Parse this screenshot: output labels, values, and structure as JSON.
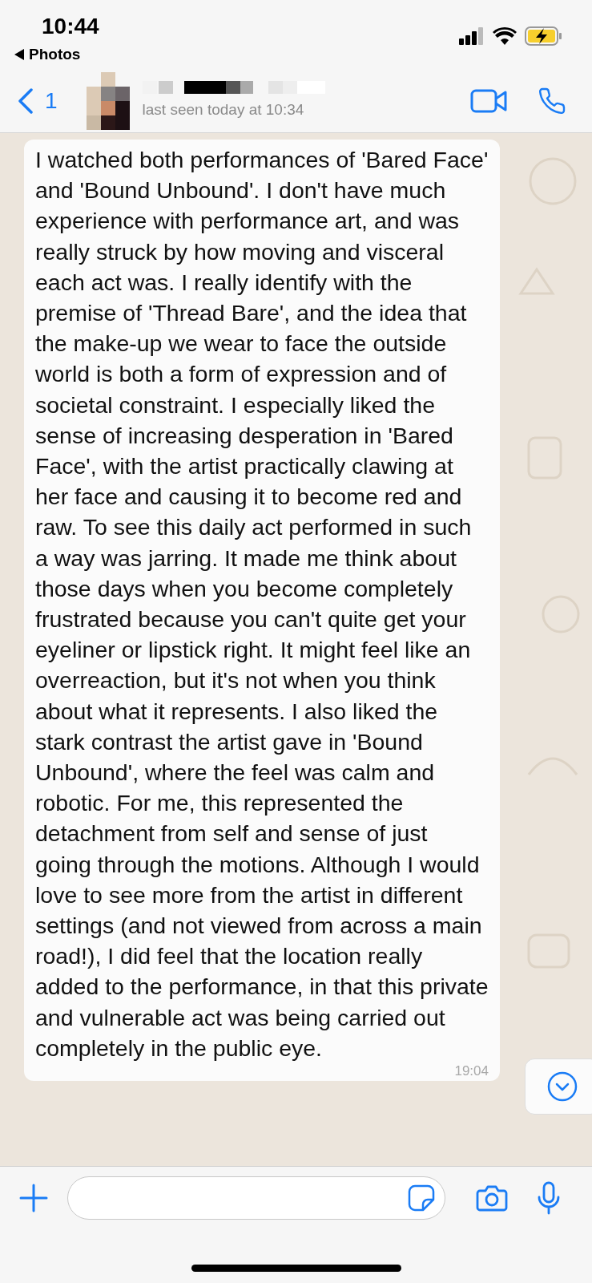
{
  "status_bar": {
    "time": "10:44",
    "back_app": "Photos"
  },
  "header": {
    "back_count": "1",
    "last_seen": "last seen today at 10:34"
  },
  "messages": [
    {
      "text": "I watched both performances of 'Bared Face' and 'Bound Unbound'. I don't have much experience with performance art, and was really struck by how moving and visceral each act was. I really identify with the premise of 'Thread Bare', and the idea that the make-up we wear to face the outside world is both a form of expression and of societal constraint. I especially liked the sense of increasing desperation in 'Bared Face', with the artist practically clawing at her face and causing it to become red and raw. To see this daily act performed in such a way was jarring. It made me think about those days when you become completely frustrated because you can't quite get your eyeliner or lipstick right. It might feel like an overreaction, but it's not when you think about what it represents. I also liked the stark contrast the artist gave in 'Bound Unbound', where the feel was calm and robotic. For me, this represented the detachment from self and sense of just going through the motions. Although I would love to see more from the artist in different settings (and not viewed from across a main road!), I did feel that the location really added to the performance, in that this private and vulnerable act was being carried out completely in the public eye.",
      "time": "19:04"
    }
  ]
}
